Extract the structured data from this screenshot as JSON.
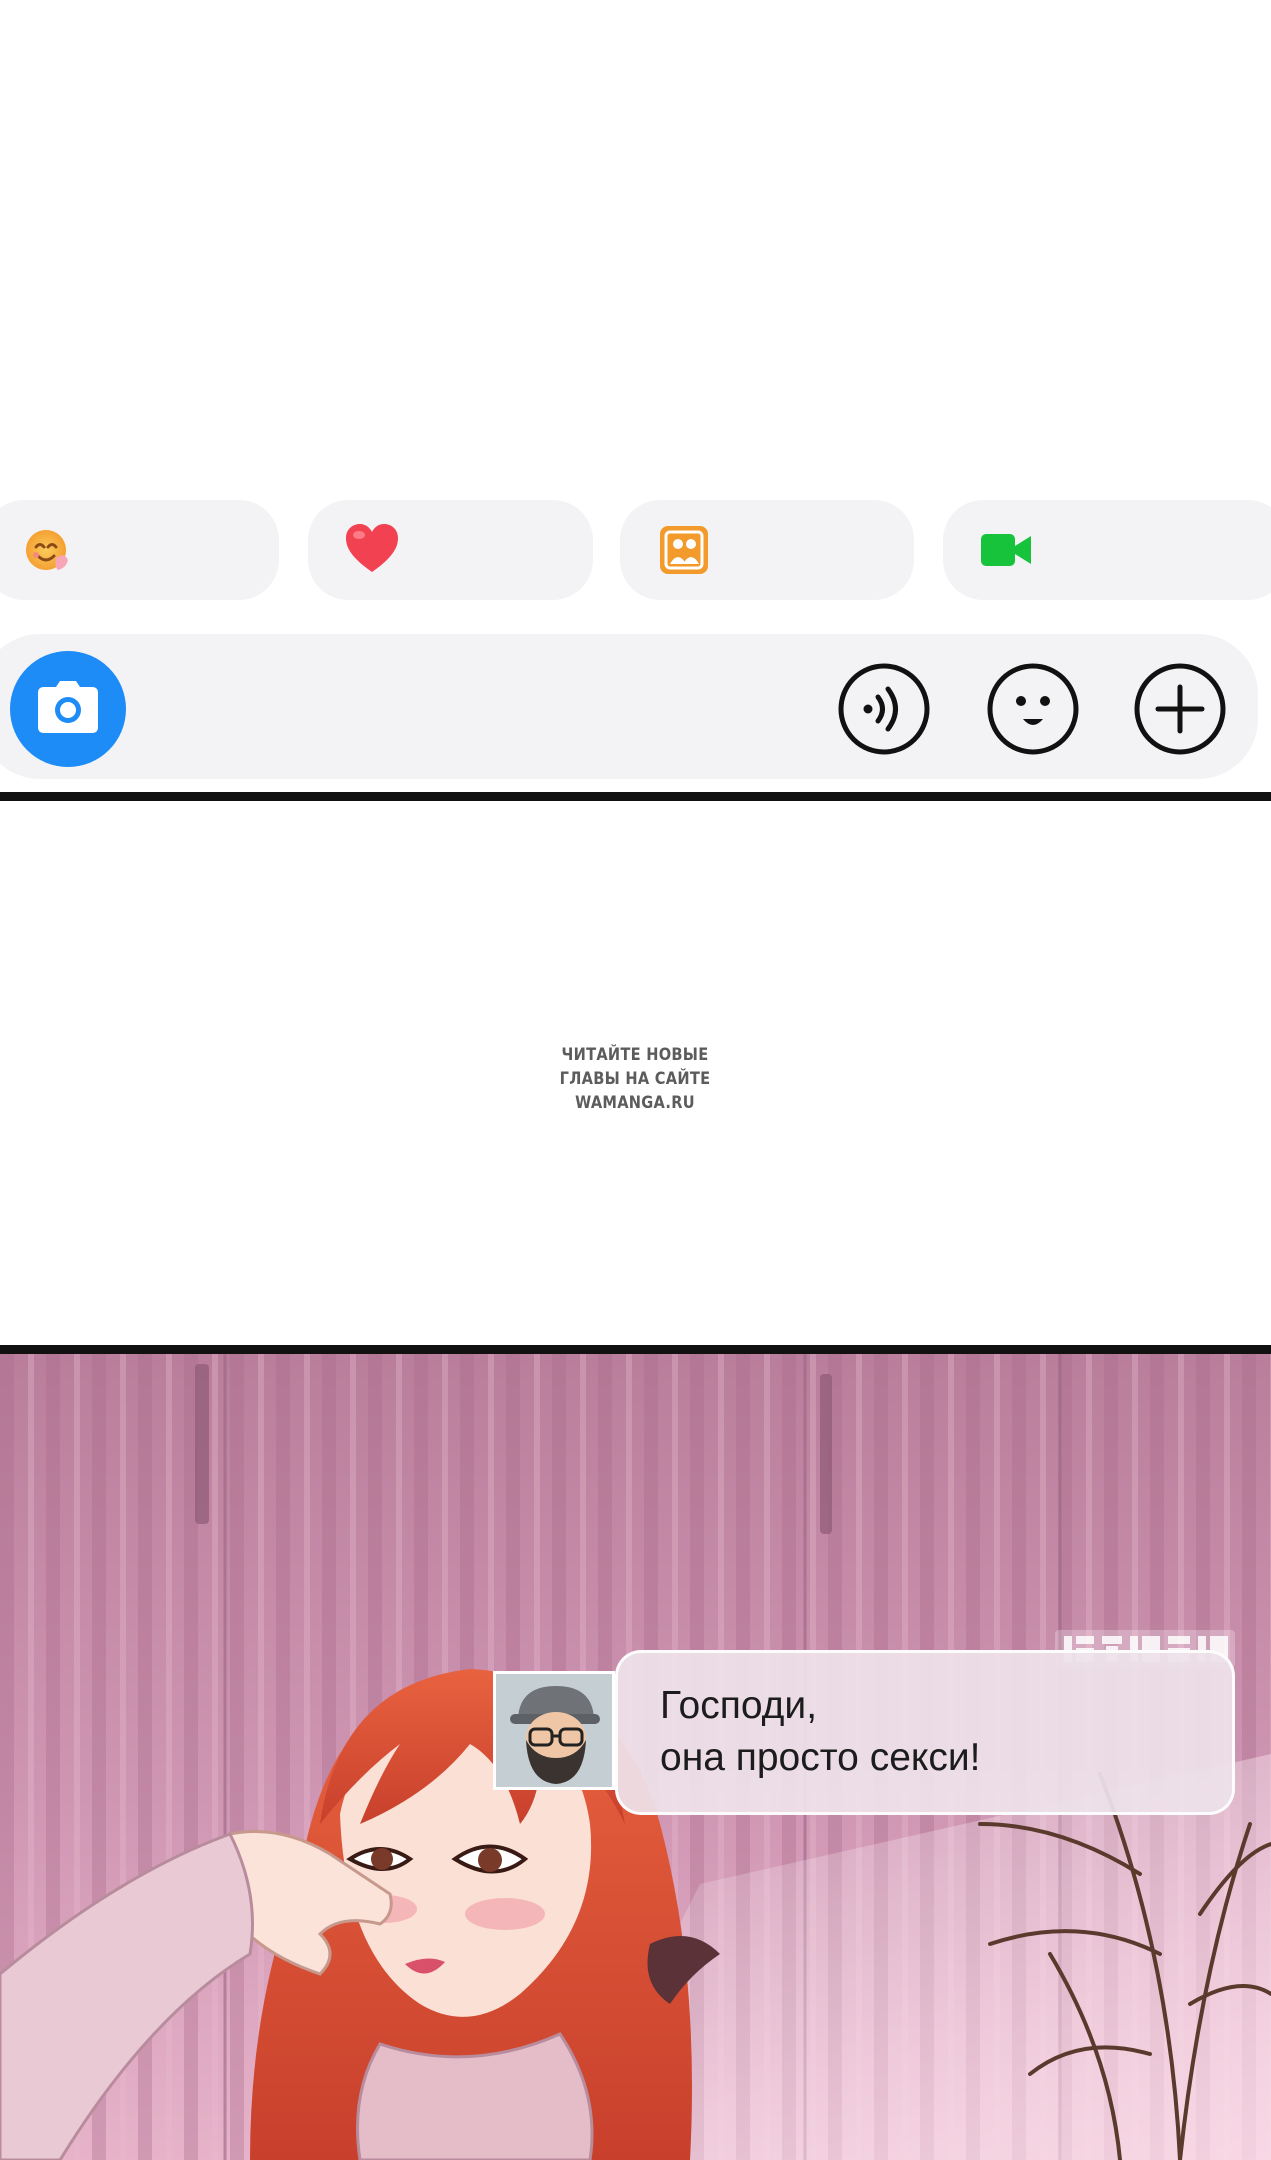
{
  "chat_ui": {
    "quick_actions": [
      {
        "name": "sticker",
        "icon": "smiling-face-icon"
      },
      {
        "name": "like",
        "icon": "heart-icon"
      },
      {
        "name": "photos",
        "icon": "gallery-icon"
      },
      {
        "name": "video-call",
        "icon": "video-camera-icon"
      }
    ],
    "input_bar": {
      "left_icon": "camera-icon",
      "right_icons": [
        "voice-icon",
        "emoji-icon",
        "plus-icon"
      ]
    },
    "colors": {
      "camera_button": "#1e8cf7",
      "heart": "#f24150",
      "gallery": "#f39a2c",
      "video": "#16c33a",
      "chip_background": "#f3f3f5"
    }
  },
  "watermark": {
    "line1": "ЧИТАЙТЕ НОВЫЕ",
    "line2": "ГЛАВЫ НА САЙТЕ",
    "line3": "WAMANGA.RU"
  },
  "speech_bubble": {
    "line1": "Господи,",
    "line2": "она просто секси!"
  }
}
